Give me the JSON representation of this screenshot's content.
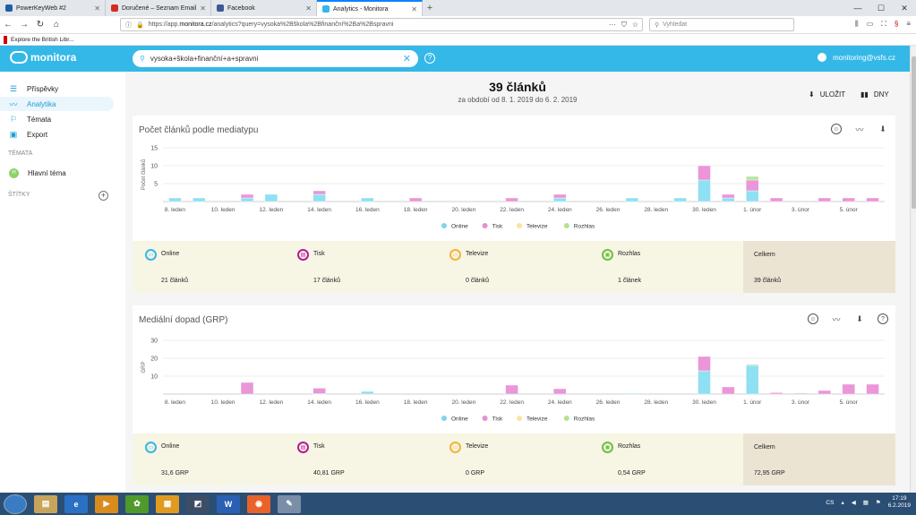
{
  "browser": {
    "tabs": [
      {
        "label": "PowerKeyWeb #2",
        "color": "#1f5ea8"
      },
      {
        "label": "Doručené – Seznam Email",
        "color": "#d52b1e"
      },
      {
        "label": "Facebook",
        "color": "#3b5998"
      },
      {
        "label": "Analytics - Monitora",
        "color": "#34b8e8"
      }
    ],
    "url_prefix": "https://app.",
    "url_host": "monitora.cz",
    "url_path": "/analytics?query=vysoka%2Bškola%2Bfinanční%2Ba%2Bspravni",
    "search_placeholder": "Vyhledat",
    "bookmark": "Explore the British Libr..."
  },
  "app": {
    "logo": "monitora",
    "search_value": "vysoka+škola+finanční+a+spravni",
    "user_email": "monitoring@vsfs.cz"
  },
  "sidebar": {
    "items": [
      {
        "label": "Příspěvky",
        "icon": "list-icon"
      },
      {
        "label": "Analytika",
        "icon": "trend-icon"
      },
      {
        "label": "Témata",
        "icon": "bookmark-icon"
      },
      {
        "label": "Export",
        "icon": "export-icon"
      }
    ],
    "topics_header": "TÉMATA",
    "topic": "Hlavní téma",
    "topic_letter": "H",
    "tags_header": "ŠTÍTKY"
  },
  "header": {
    "title": "39 článků",
    "subtitle": "za období od 8. 1. 2019 do 6. 2. 2019",
    "save_label": "ULOŽIT",
    "days_label": "DNY"
  },
  "stats_labels": {
    "online": "Online",
    "tisk": "Tisk",
    "televize": "Televize",
    "rozhlas": "Rozhlas",
    "celkem": "Celkem"
  },
  "stats1": {
    "online": "21 článků",
    "tisk": "17 článků",
    "televize": "0 článků",
    "rozhlas": "1 článek",
    "celkem": "39 článků"
  },
  "stats2": {
    "online": "31,6 GRP",
    "tisk": "40,81 GRP",
    "televize": "0 GRP",
    "rozhlas": "0,54 GRP",
    "celkem": "72,95 GRP"
  },
  "colors": {
    "online": "#8fe0f2",
    "tisk": "#ea96d8",
    "televize": "#ffe5a6",
    "rozhlas": "#b9e69a"
  },
  "taskbar": {
    "lang": "CS",
    "time": "17:19",
    "date": "6.2.2019"
  },
  "chart_data": [
    {
      "type": "bar",
      "title": "Počet článků podle mediatypu",
      "ylabel": "Počet článků",
      "ylim": [
        0,
        15
      ],
      "yticks": [
        5,
        10,
        15
      ],
      "x": [
        "8.1",
        "9.1",
        "10.1",
        "11.1",
        "12.1",
        "13.1",
        "14.1",
        "15.1",
        "16.1",
        "17.1",
        "18.1",
        "19.1",
        "20.1",
        "21.1",
        "22.1",
        "23.1",
        "24.1",
        "25.1",
        "26.1",
        "27.1",
        "28.1",
        "29.1",
        "30.1",
        "31.1",
        "1.2",
        "2.2",
        "3.2",
        "4.2",
        "5.2",
        "6.2"
      ],
      "xticklabels": [
        "8. leden",
        "10. leden",
        "12. leden",
        "14. leden",
        "16. leden",
        "18. leden",
        "20. leden",
        "22. leden",
        "24. leden",
        "26. leden",
        "28. leden",
        "30. leden",
        "1. únor",
        "3. únor",
        "5. únor"
      ],
      "legend": [
        "Online",
        "Tisk",
        "Televize",
        "Rozhlas"
      ],
      "series": [
        {
          "name": "Online",
          "values": [
            1,
            1,
            0,
            1,
            2,
            0,
            2,
            0,
            1,
            0,
            0,
            0,
            0,
            0,
            0,
            0,
            1,
            0,
            0,
            1,
            0,
            1,
            6,
            1,
            3,
            0,
            0,
            0,
            0,
            0
          ]
        },
        {
          "name": "Tisk",
          "values": [
            0,
            0,
            0,
            1,
            0,
            0,
            1,
            0,
            0,
            0,
            1,
            0,
            0,
            0,
            1,
            0,
            1,
            0,
            0,
            0,
            0,
            0,
            4,
            1,
            3,
            1,
            0,
            1,
            1,
            1
          ]
        },
        {
          "name": "Televize",
          "values": [
            0,
            0,
            0,
            0,
            0,
            0,
            0,
            0,
            0,
            0,
            0,
            0,
            0,
            0,
            0,
            0,
            0,
            0,
            0,
            0,
            0,
            0,
            0,
            0,
            0,
            0,
            0,
            0,
            0,
            0
          ]
        },
        {
          "name": "Rozhlas",
          "values": [
            0,
            0,
            0,
            0,
            0,
            0,
            0,
            0,
            0,
            0,
            0,
            0,
            0,
            0,
            0,
            0,
            0,
            0,
            0,
            0,
            0,
            0,
            0,
            0,
            1,
            0,
            0,
            0,
            0,
            0
          ]
        }
      ]
    },
    {
      "type": "bar",
      "title": "Mediální dopad (GRP)",
      "ylabel": "GRP",
      "ylim": [
        0,
        30
      ],
      "yticks": [
        10,
        20,
        30
      ],
      "x": [
        "8.1",
        "9.1",
        "10.1",
        "11.1",
        "12.1",
        "13.1",
        "14.1",
        "15.1",
        "16.1",
        "17.1",
        "18.1",
        "19.1",
        "20.1",
        "21.1",
        "22.1",
        "23.1",
        "24.1",
        "25.1",
        "26.1",
        "27.1",
        "28.1",
        "29.1",
        "30.1",
        "31.1",
        "1.2",
        "2.2",
        "3.2",
        "4.2",
        "5.2",
        "6.2"
      ],
      "xticklabels": [
        "8. leden",
        "10. leden",
        "12. leden",
        "14. leden",
        "16. leden",
        "18. leden",
        "20. leden",
        "22. leden",
        "24. leden",
        "26. leden",
        "28. leden",
        "30. leden",
        "1. únor",
        "3. únor",
        "5. únor"
      ],
      "legend": [
        "Online",
        "Tisk",
        "Televize",
        "Rozhlas"
      ],
      "series": [
        {
          "name": "Online",
          "values": [
            0,
            0,
            0,
            0,
            0,
            0,
            0.3,
            0,
            1.5,
            0,
            0,
            0,
            0,
            0,
            0,
            0,
            0,
            0,
            0,
            0.5,
            0,
            0,
            13,
            0,
            16,
            0,
            0,
            0,
            0,
            0
          ]
        },
        {
          "name": "Tisk",
          "values": [
            0,
            0,
            0,
            6.5,
            0,
            0,
            3,
            0,
            0,
            0,
            0,
            0,
            0,
            0,
            5,
            0,
            3,
            0,
            0,
            0,
            0,
            0,
            8,
            4,
            0,
            0.8,
            0.5,
            2,
            5.5,
            5.5
          ]
        },
        {
          "name": "Televize",
          "values": [
            0,
            0,
            0,
            0,
            0,
            0,
            0,
            0,
            0,
            0,
            0,
            0,
            0,
            0,
            0,
            0,
            0,
            0,
            0,
            0,
            0,
            0,
            0,
            0,
            0,
            0,
            0,
            0,
            0,
            0
          ]
        },
        {
          "name": "Rozhlas",
          "values": [
            0,
            0,
            0,
            0,
            0,
            0,
            0,
            0,
            0,
            0,
            0,
            0,
            0,
            0,
            0,
            0,
            0,
            0,
            0,
            0,
            0,
            0,
            0,
            0,
            0.6,
            0,
            0,
            0,
            0,
            0
          ]
        }
      ]
    }
  ]
}
